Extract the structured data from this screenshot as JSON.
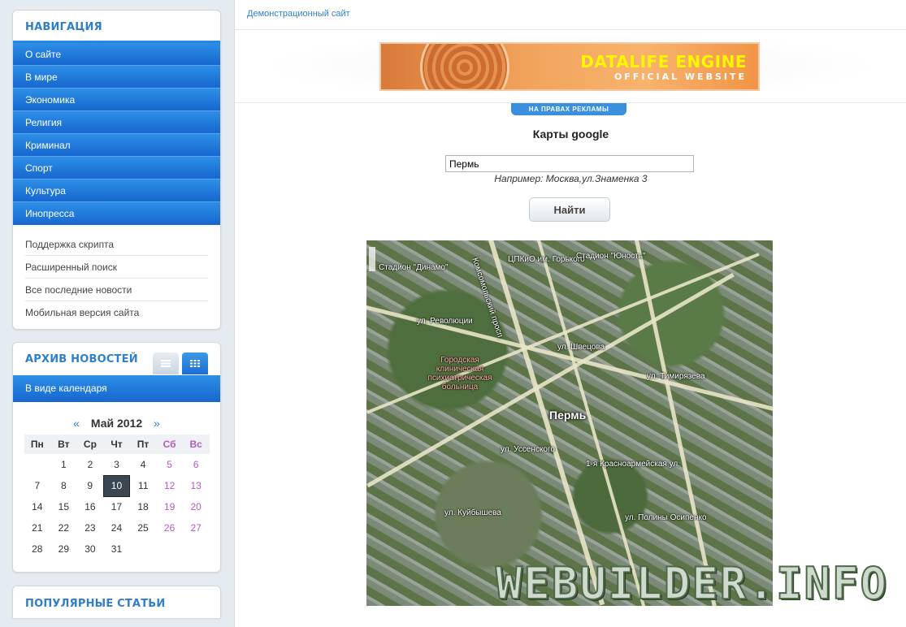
{
  "navigation": {
    "title": "Навигация",
    "primary_items": [
      "О сайте",
      "В мире",
      "Экономика",
      "Религия",
      "Криминал",
      "Спорт",
      "Культура",
      "Инопресса"
    ],
    "secondary_items": [
      "Поддержка скрипта",
      "Расширенный поиск",
      "Все последние новости",
      "Мобильная версия сайта"
    ]
  },
  "archive": {
    "title": "Архив новостей",
    "tabs": [
      "list-icon",
      "grid-icon"
    ],
    "active_tab": "grid-icon",
    "calendar_label": "В виде календаря",
    "calendar": {
      "prev": "«",
      "next": "»",
      "month_label": "Май 2012",
      "weekdays": [
        "Пн",
        "Вт",
        "Ср",
        "Чт",
        "Пт",
        "Сб",
        "Вс"
      ],
      "weeks": [
        [
          "",
          "1",
          "2",
          "3",
          "4",
          "5",
          "6"
        ],
        [
          "7",
          "8",
          "9",
          "10",
          "11",
          "12",
          "13"
        ],
        [
          "14",
          "15",
          "16",
          "17",
          "18",
          "19",
          "20"
        ],
        [
          "21",
          "22",
          "23",
          "24",
          "25",
          "26",
          "27"
        ],
        [
          "28",
          "29",
          "30",
          "31",
          "",
          "",
          ""
        ]
      ],
      "today": "10",
      "weekend_color": "#b659c2"
    }
  },
  "popular": {
    "title": "Популярные статьи"
  },
  "main": {
    "breadcrumb": "Демонстрационный сайт",
    "banner": {
      "line1": "DATALIFE ENGINE",
      "line2": "OFFICIAL WEBSITE"
    },
    "ad_label": "НА ПРАВАХ РЕКЛАМЫ",
    "title": "Карты google",
    "search_value": "Пермь",
    "hint": "Например: Москва,ул.Знаменка 3",
    "find_button": "Найти",
    "map": {
      "city_label": "Пермь",
      "labels": [
        "Стадион \"Динамо\"",
        "ЦПКиО им. Горького",
        "Стадион \"Юность\"",
        "ул. Революции",
        "ул. Швецова",
        "ул. Тимирязева",
        "Городская клиническая психиатрическая больница",
        "ул. Уссенского",
        "Комсомольский просп.",
        "1-я Красноармейская ул.",
        "ул. Полины Осипенко",
        "ул. Куйбышева"
      ]
    },
    "watermark": "WEBUILDER.INFO"
  },
  "colors": {
    "accent": "#2f7fc8",
    "nav_blue": "#1767cf",
    "page_bg": "#e4ebf1"
  }
}
